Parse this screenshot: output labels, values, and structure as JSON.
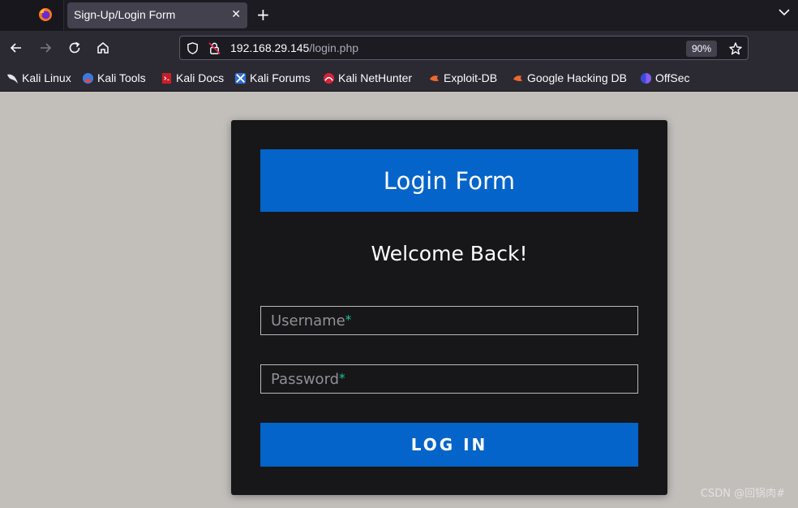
{
  "browser": {
    "tab_title": "Sign-Up/Login Form",
    "tab_close": "✕",
    "new_tab": "+",
    "url_host": "192.168.29.145",
    "url_path": "/login.php",
    "zoom": "90%",
    "icons": {
      "firefox": "firefox-icon",
      "back": "back-arrow-icon",
      "forward": "forward-arrow-icon",
      "reload": "reload-icon",
      "home": "home-icon",
      "shield": "shield-icon",
      "insecure": "insecure-lock-icon",
      "star": "star-icon",
      "tab_list": "chevron-down-icon"
    },
    "bookmarks": [
      {
        "label": "Kali Linux",
        "icon": "kali-dragon-icon"
      },
      {
        "label": "Kali Tools",
        "icon": "kali-tools-icon"
      },
      {
        "label": "Kali Docs",
        "icon": "kali-docs-icon"
      },
      {
        "label": "Kali Forums",
        "icon": "kali-forums-icon"
      },
      {
        "label": "Kali NetHunter",
        "icon": "nethunter-icon"
      },
      {
        "label": "Exploit-DB",
        "icon": "exploit-db-icon"
      },
      {
        "label": "Google Hacking DB",
        "icon": "ghdb-icon"
      },
      {
        "label": "OffSec",
        "icon": "offsec-icon"
      }
    ]
  },
  "form": {
    "title": "Login Form",
    "welcome": "Welcome Back!",
    "username_placeholder": "Username",
    "password_placeholder": "Password",
    "required_mark": "*",
    "login_button": "LOG IN"
  },
  "watermark": "CSDN @回锅肉#",
  "colors": {
    "accent_blue": "#0464c9",
    "card_bg": "#17171a",
    "page_bg": "#c2bfbb",
    "required_green": "#1bc39a"
  }
}
